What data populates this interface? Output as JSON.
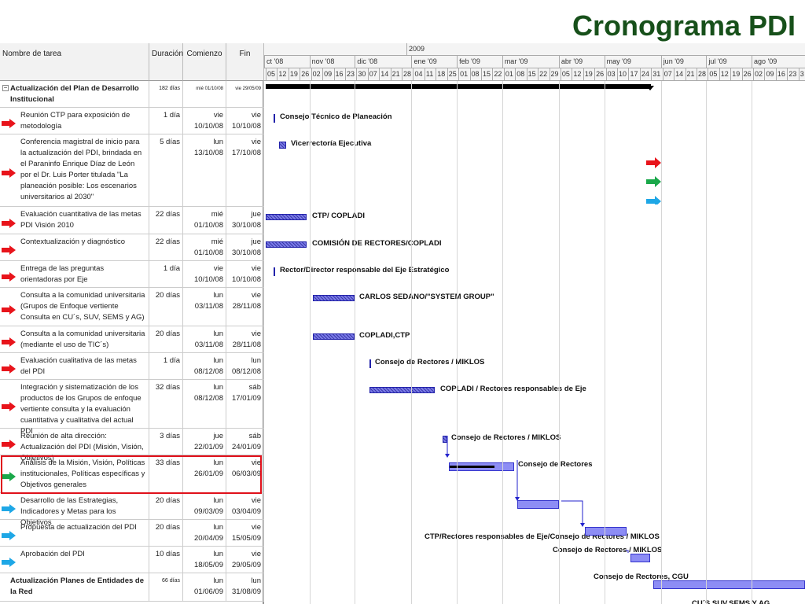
{
  "title": "Cronograma PDI",
  "columns": {
    "name": "Nombre de tarea",
    "duration": "Duración",
    "start": "Comienzo",
    "end": "Fin"
  },
  "timescale": {
    "year": "2009",
    "months": [
      "ct '08",
      "nov '08",
      "dic '08",
      "ene '09",
      "feb '09",
      "mar '09",
      "abr '09",
      "may '09",
      "jun '09",
      "jul '09",
      "ago '09"
    ],
    "weeks": [
      "05",
      "12",
      "19",
      "26",
      "02",
      "09",
      "16",
      "23",
      "30",
      "07",
      "14",
      "21",
      "28",
      "04",
      "11",
      "18",
      "25",
      "01",
      "08",
      "15",
      "22",
      "01",
      "08",
      "15",
      "22",
      "29",
      "05",
      "12",
      "19",
      "26",
      "03",
      "10",
      "17",
      "24",
      "31",
      "07",
      "14",
      "21",
      "28",
      "05",
      "12",
      "19",
      "26",
      "02",
      "09",
      "16",
      "23",
      "3"
    ]
  },
  "tasks": [
    {
      "name": "Actualización del Plan de Desarrollo Institucional",
      "duration": "182 días",
      "start": "mié 01/10/08",
      "end": "vie 29/05/09",
      "summary": true,
      "resource": ""
    },
    {
      "name": "Reunión CTP para exposición de metodología",
      "duration": "1 día",
      "start": "vie 10/10/08",
      "end": "vie 10/10/08",
      "arrow": "red",
      "resource": "Consejo Técnico de Planeación"
    },
    {
      "name": "Conferencia magistral de inicio para la actualización del PDI, brindada en el Paraninfo Enrique Díaz de León por el Dr. Luis Porter titulada \"La planeación posible: Los escenarios universitarios al 2030\"",
      "duration": "5 días",
      "start": "lun 13/10/08",
      "end": "vie 17/10/08",
      "arrow": "red",
      "resource": "Vicerrectoría Ejecutiva"
    },
    {
      "name": "Evaluación cuantitativa de las metas PDI Visión 2010",
      "duration": "22 días",
      "start": "mié 01/10/08",
      "end": "jue 30/10/08",
      "arrow": "red",
      "resource": "CTP/ COPLADI"
    },
    {
      "name": "Contextualización y diagnóstico",
      "duration": "22 días",
      "start": "mié 01/10/08",
      "end": "jue 30/10/08",
      "arrow": "red",
      "resource": "COMISIÓN DE RECTORES/COPLADI"
    },
    {
      "name": "Entrega de las preguntas orientadoras por Eje",
      "duration": "1 día",
      "start": "vie 10/10/08",
      "end": "vie 10/10/08",
      "arrow": "red",
      "resource": "Rector/Director responsable del Eje Estratégico"
    },
    {
      "name": "Consulta a la comunidad universitaria (Grupos de Enfoque vertiente Consulta en CU´s, SUV, SEMS y AG)",
      "duration": "20 días",
      "start": "lun 03/11/08",
      "end": "vie 28/11/08",
      "arrow": "red",
      "resource": "CARLOS SEDANO/\"SYSTEM GROUP\""
    },
    {
      "name": "Consulta a la comunidad universitaria (mediante el uso de TIC´s)",
      "duration": "20 días",
      "start": "lun 03/11/08",
      "end": "vie 28/11/08",
      "arrow": "red",
      "resource": "COPLADI,CTP"
    },
    {
      "name": "Evaluación cualitativa de las metas del PDI",
      "duration": "1 día",
      "start": "lun 08/12/08",
      "end": "lun 08/12/08",
      "arrow": "red",
      "resource": "Consejo de Rectores / MIKLOS"
    },
    {
      "name": "Integración y sistematización  de los productos de los Grupos de enfoque vertiente consulta y la evaluación cuantitativa y cualitativa del actual PDI",
      "duration": "32 días",
      "start": "lun 08/12/08",
      "end": "sáb 17/01/09",
      "arrow": "red",
      "resource": "COPLADI / Rectores responsables de Eje"
    },
    {
      "name": "Reunión de alta dirección:  Actualización del PDI (Misión, Visión, Objetivos)",
      "duration": "3 días",
      "start": "jue 22/01/09",
      "end": "sáb 24/01/09",
      "arrow": "red",
      "resource": "Consejo de Rectores / MIKLOS"
    },
    {
      "name": "Análisis de la Misión, Visión, Políticas institucionales, Políticas específicas y Objetivos generales",
      "duration": "33 días",
      "start": "lun 26/01/09",
      "end": "vie 06/03/09",
      "arrow": "green",
      "resource": "Consejo de Rectores"
    },
    {
      "name": "Desarrollo de las Estrategias, Indicadores y Metas para los Objetivos",
      "duration": "20 días",
      "start": "lun 09/03/09",
      "end": "vie 03/04/09",
      "arrow": "blue",
      "resource": "CTP/Rectores responsables de Eje/Consejo de Rectores / MIKLOS"
    },
    {
      "name": " Propuesta de actualización  del PDI",
      "duration": "20 días",
      "start": "lun 20/04/09",
      "end": "vie 15/05/09",
      "arrow": "blue",
      "resource": "Consejo de Rectores / MIKLOS"
    },
    {
      "name": "Aprobación del PDI",
      "duration": "10 días",
      "start": "lun 18/05/09",
      "end": "vie 29/05/09",
      "arrow": "blue",
      "resource": "Consejo de Rectores,  CGU"
    },
    {
      "name": "Actualización Planes de Entidades de la Red",
      "duration": "66 días",
      "start": "lun 01/06/09",
      "end": "lun 31/08/09",
      "summary": true,
      "resource": "CU´S,SUV,SEMS Y AG"
    }
  ],
  "colors": {
    "red": "#e8141b",
    "green": "#1aa84a",
    "blue": "#1ea7e6",
    "title": "#17501a",
    "highlight": "#e0101a"
  }
}
